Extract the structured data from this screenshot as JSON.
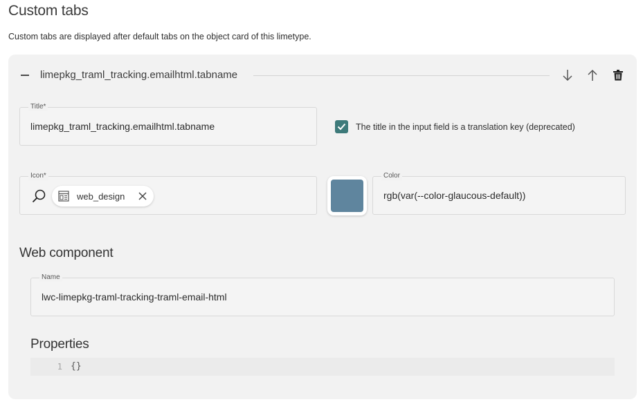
{
  "page": {
    "title": "Custom tabs",
    "description": "Custom tabs are displayed after default tabs on the object card of this limetype."
  },
  "tab_card": {
    "header_title": "limepkg_traml_tracking.emailhtml.tabname",
    "collapse_icon": "minus-icon",
    "actions": [
      {
        "name": "move-down",
        "icon": "arrow-down-icon"
      },
      {
        "name": "move-up",
        "icon": "arrow-up-icon"
      },
      {
        "name": "delete",
        "icon": "trash-icon"
      }
    ],
    "title_field": {
      "label": "Title*",
      "value": "limepkg_traml_tracking.emailhtml.tabname"
    },
    "translation_checkbox": {
      "label": "The title in the input field is a translation key (deprecated)",
      "checked": true,
      "color": "#3d7a7a"
    },
    "icon_field": {
      "label": "Icon*",
      "search_icon": "search-icon",
      "chip_label": "web_design",
      "chip_icon": "web-design-icon"
    },
    "color_field": {
      "label": "Color",
      "value": "rgb(var(--color-glaucous-default))",
      "swatch_color": "#5f859e"
    },
    "web_component": {
      "section_title": "Web component",
      "name_field": {
        "label": "Name",
        "value": "lwc-limepkg-traml-tracking-traml-email-html"
      }
    },
    "properties": {
      "section_title": "Properties",
      "lines": [
        {
          "number": "1",
          "code": "{}"
        }
      ]
    }
  }
}
